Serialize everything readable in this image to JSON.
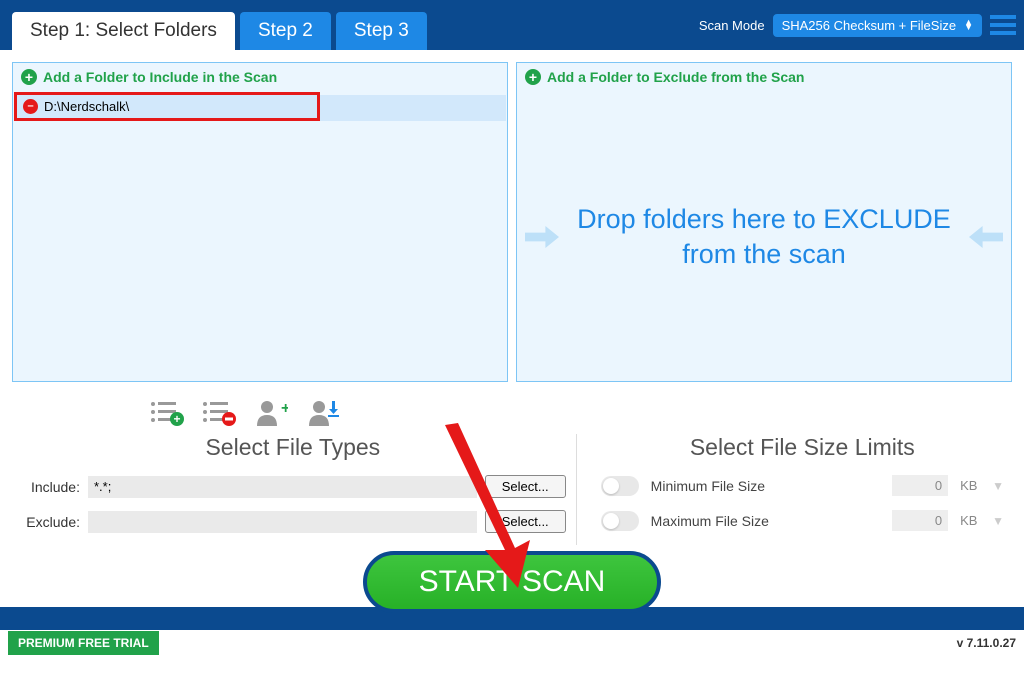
{
  "tabs": [
    {
      "label": "Step 1: Select Folders",
      "active": true
    },
    {
      "label": "Step 2",
      "active": false
    },
    {
      "label": "Step 3",
      "active": false
    }
  ],
  "scanmode": {
    "label": "Scan Mode",
    "value": "SHA256 Checksum + FileSize"
  },
  "include_panel": {
    "head": "Add a Folder to Include in the Scan",
    "items": [
      "D:\\Nerdschalk\\"
    ]
  },
  "exclude_panel": {
    "head": "Add a Folder to Exclude from the Scan",
    "drop_text": "Drop folders here to EXCLUDE from the scan"
  },
  "file_types": {
    "title": "Select File Types",
    "include_label": "Include:",
    "include_value": "*.*;",
    "exclude_label": "Exclude:",
    "exclude_value": "",
    "select_btn": "Select..."
  },
  "file_size": {
    "title": "Select File Size Limits",
    "min_label": "Minimum File Size",
    "max_label": "Maximum File Size",
    "min_value": "0",
    "max_value": "0",
    "unit": "KB"
  },
  "start_btn": "START SCAN",
  "trial": "PREMIUM FREE TRIAL",
  "version": "v 7.11.0.27"
}
